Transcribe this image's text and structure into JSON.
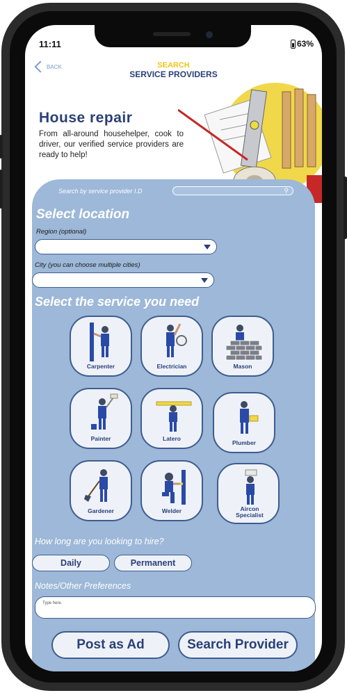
{
  "status": {
    "time": "11:11",
    "battery": "63%"
  },
  "header": {
    "back_label": "BACK",
    "title_line1": "SEARCH",
    "title_line2": "SERVICE PROVIDERS"
  },
  "hero": {
    "title": "House repair",
    "description": "From all-around househelper, cook to driver, our verified service providers are ready to help!"
  },
  "search": {
    "label": "Search by service provider I.D",
    "value": ""
  },
  "location": {
    "heading": "Select location",
    "region_label": "Region (optional)",
    "region_value": "",
    "city_label": "City (you can choose multiple cities)",
    "city_value": ""
  },
  "services": {
    "heading": "Select the service you need",
    "items": [
      {
        "label": "Carpenter"
      },
      {
        "label": "Electrician"
      },
      {
        "label": "Mason"
      },
      {
        "label": "Painter"
      },
      {
        "label": "Latero"
      },
      {
        "label": "Plumber"
      },
      {
        "label": "Gardener"
      },
      {
        "label": "Welder"
      },
      {
        "label": "Aircon Specialist"
      }
    ]
  },
  "hire": {
    "question": "How long are you looking to hire?",
    "options": [
      "Daily",
      "Permanent"
    ]
  },
  "notes": {
    "heading": "Notes/Other Preferences",
    "placeholder": "Type here."
  },
  "actions": {
    "post_label": "Post as Ad",
    "search_label": "Search Provider"
  },
  "colors": {
    "primary": "#2a3f78",
    "accent": "#f2c419",
    "panel": "#9db8d8",
    "tile_border": "#3e5c8f"
  }
}
